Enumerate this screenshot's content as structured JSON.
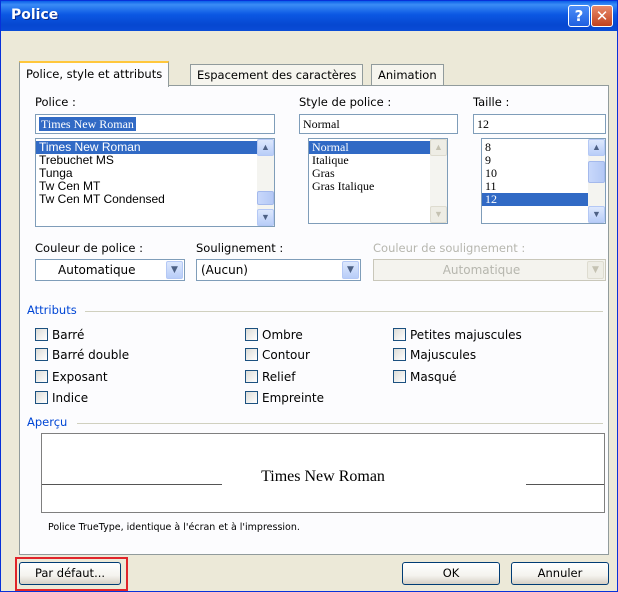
{
  "window": {
    "title": "Police",
    "help_glyph": "?",
    "close_glyph": "✕"
  },
  "tabs": [
    {
      "label": "Police, style et attributs",
      "active": true
    },
    {
      "label": "Espacement des caractères",
      "active": false
    },
    {
      "label": "Animation",
      "active": false
    }
  ],
  "font": {
    "label": "Police :",
    "value": "Times New Roman",
    "items": [
      "Times New Roman",
      "Trebuchet MS",
      "Tunga",
      "Tw Cen MT",
      "Tw Cen MT Condensed"
    ]
  },
  "style": {
    "label": "Style de police :",
    "value": "Normal",
    "items": [
      "Normal",
      "Italique",
      "Gras",
      "Gras Italique"
    ]
  },
  "size": {
    "label": "Taille :",
    "value": "12",
    "items": [
      "8",
      "9",
      "10",
      "11",
      "12"
    ]
  },
  "color": {
    "label": "Couleur de police :",
    "value": "Automatique"
  },
  "underline": {
    "label": "Soulignement :",
    "value": "(Aucun)"
  },
  "underline_color": {
    "label": "Couleur de soulignement :",
    "value": "Automatique"
  },
  "attributes": {
    "title": "Attributs",
    "col1": [
      "Barré",
      "Barré double",
      "Exposant",
      "Indice"
    ],
    "col2": [
      "Ombre",
      "Contour",
      "Relief",
      "Empreinte"
    ],
    "col3": [
      "Petites majuscules",
      "Majuscules",
      "Masqué"
    ]
  },
  "preview": {
    "title": "Aperçu",
    "text": "Times New Roman",
    "note": "Police TrueType, identique à l'écran et à l'impression."
  },
  "buttons": {
    "default": "Par défaut...",
    "ok": "OK",
    "cancel": "Annuler"
  },
  "colors": {
    "titlebar": "#0a4cd6",
    "accent": "#316ac5",
    "highlight_box": "#e0242a"
  }
}
